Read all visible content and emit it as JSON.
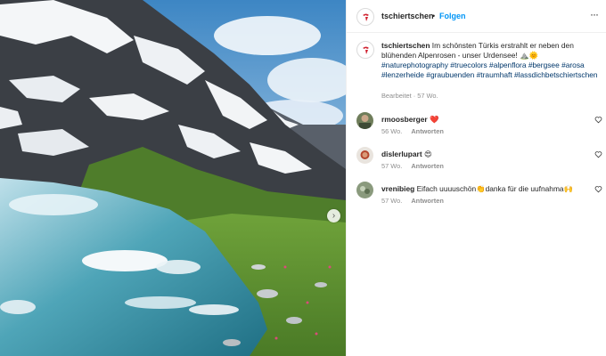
{
  "post": {
    "image_alt": "Alpine lake Urdensee with snowy mountains and green meadow",
    "next_icon": "chevron-right-icon"
  },
  "header": {
    "username": "tschiertschen",
    "separator": "•",
    "follow_label": "Folgen",
    "more_label": "···"
  },
  "caption": {
    "username": "tschiertschen",
    "text": "Im schönsten Türkis erstrahlt er neben den blühenden Alpenrosen - unser Urdensee! ⛰️🌞",
    "hashtags": "#naturephotography #truecolors #alpenflora #bergsee #arosa #lenzerheide #graubuenden #traumhaft #lassdichbetschiertschen",
    "meta": "Bearbeitet · 57 Wo."
  },
  "comments": [
    {
      "username": "rmoosberger",
      "text": "❤️",
      "age": "56 Wo.",
      "reply_label": "Antworten"
    },
    {
      "username": "dislerlupart",
      "text": "😍",
      "age": "57 Wo.",
      "reply_label": "Antworten"
    },
    {
      "username": "vrenibieg",
      "text": "Eifach uuuuschön👏danka für die uufnahma🙌",
      "age": "57 Wo.",
      "reply_label": "Antworten"
    }
  ],
  "colors": {
    "link_blue": "#0095f6",
    "hashtag_blue": "#00376b",
    "muted": "#8e8e8e",
    "brand_red": "#d0202e"
  }
}
